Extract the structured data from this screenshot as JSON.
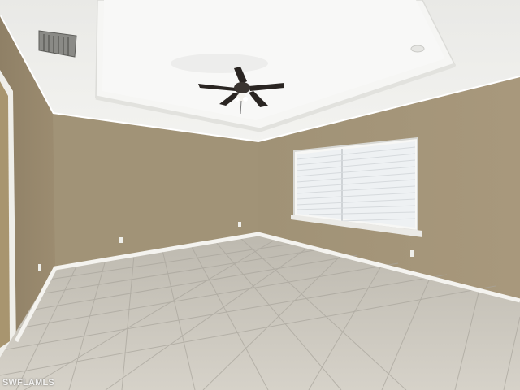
{
  "photo": {
    "watermark": "SWFLAMLS"
  },
  "colors": {
    "ceiling": "#f2f2ef",
    "tray_ceiling": "#f7f7f5",
    "wall_left": "#9c8c70",
    "wall_back": "#a09276",
    "wall_right": "#a39378",
    "floor": "#cfcbc2",
    "trim": "#f4f3ef",
    "window_blind": "#eef1f3"
  }
}
